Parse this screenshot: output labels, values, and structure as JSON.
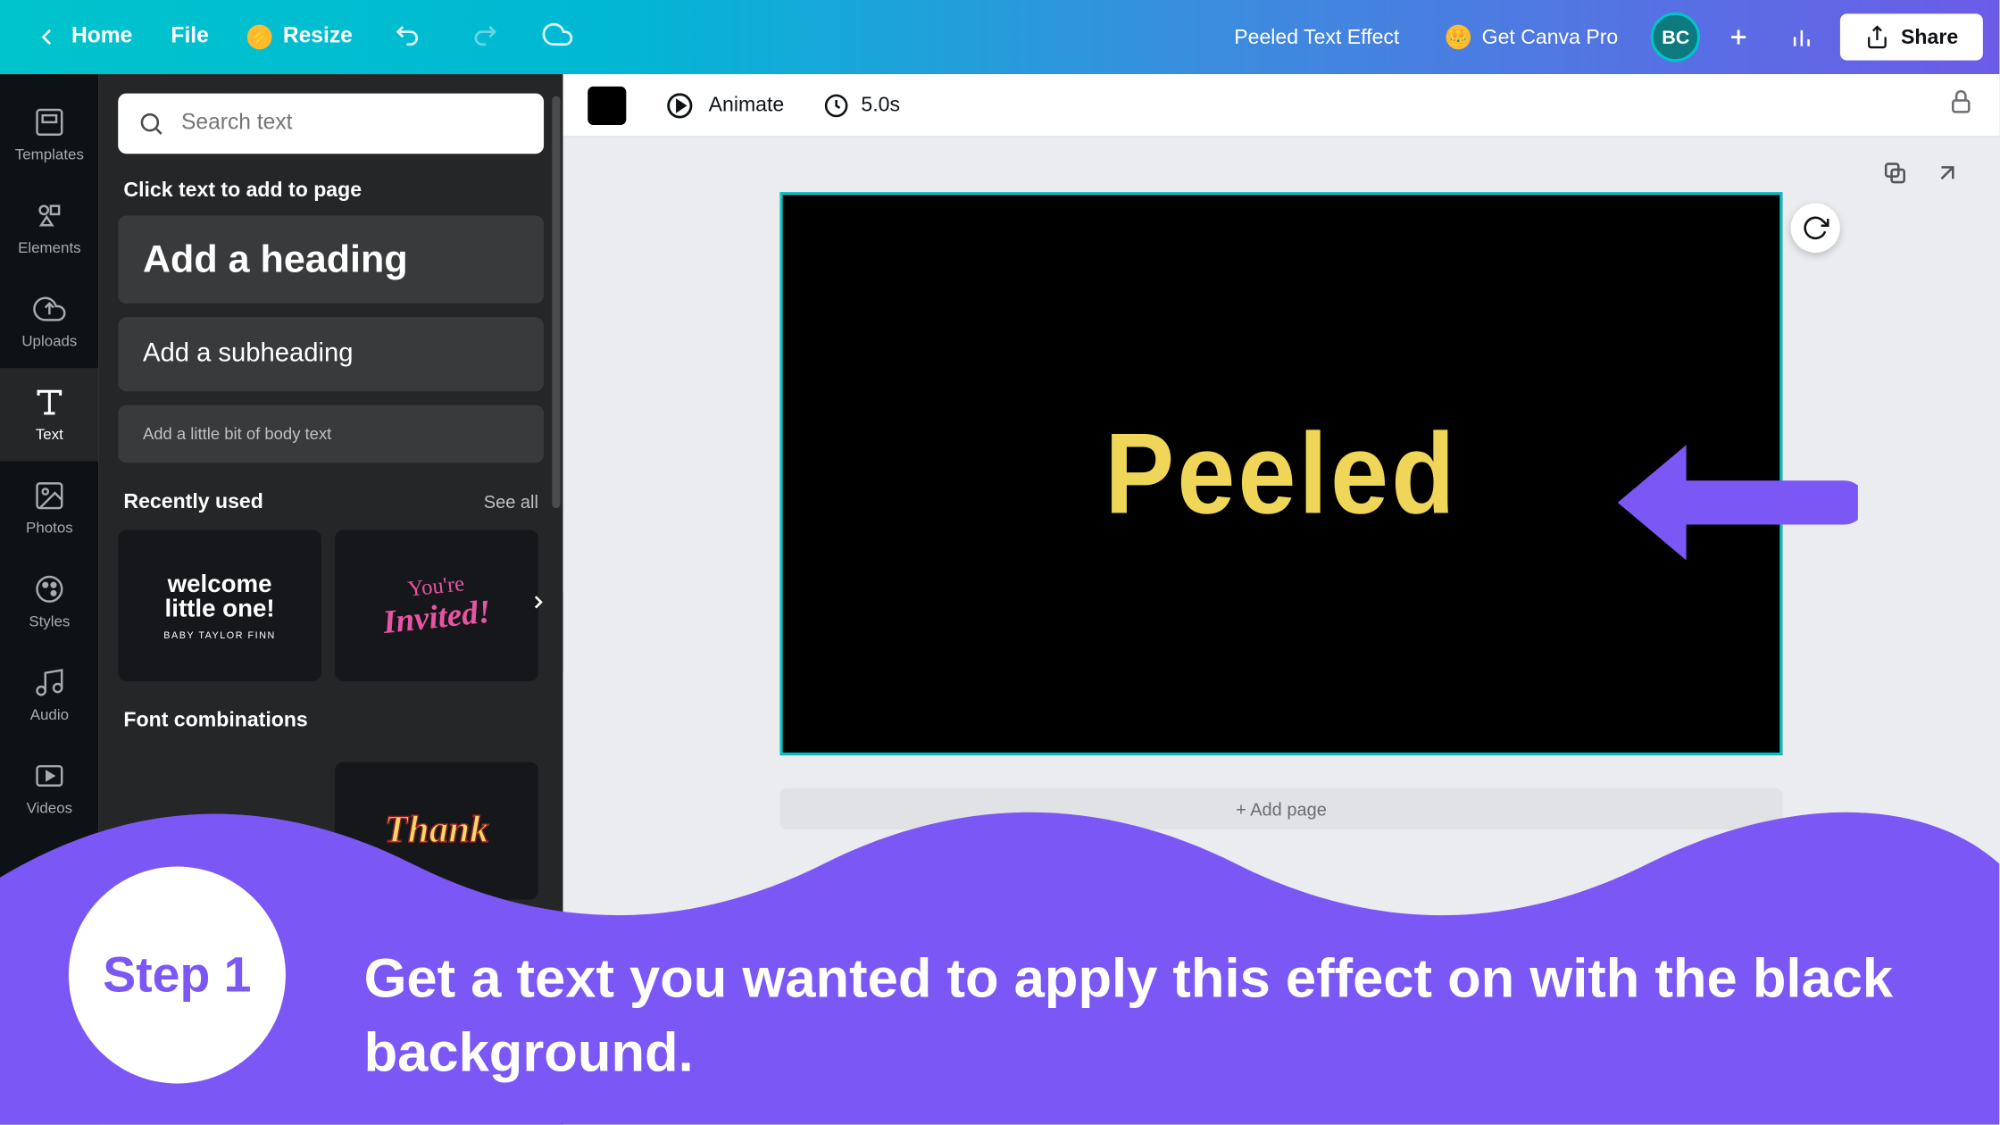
{
  "topbar": {
    "home": "Home",
    "file": "File",
    "resize": "Resize",
    "doc_title": "Peeled Text Effect",
    "get_pro": "Get Canva Pro",
    "avatar_initials": "BC",
    "share": "Share"
  },
  "rail": {
    "templates": "Templates",
    "elements": "Elements",
    "uploads": "Uploads",
    "text": "Text",
    "photos": "Photos",
    "styles": "Styles",
    "audio": "Audio",
    "videos": "Videos"
  },
  "sidepanel": {
    "search_placeholder": "Search text",
    "click_hint": "Click text to add to page",
    "heading": "Add a heading",
    "subheading": "Add a subheading",
    "body": "Add a little bit of body text",
    "recently_used": "Recently used",
    "see_all": "See all",
    "font_combos": "Font combinations",
    "card1_line1": "welcome",
    "card1_line2": "little one!",
    "card1_sub": "BABY TAYLOR FINN",
    "card2_line1": "You're",
    "card2_line2": "Invited!",
    "thank": "Thank"
  },
  "toolbar": {
    "animate": "Animate",
    "duration": "5.0s"
  },
  "canvas": {
    "text": "Peeled",
    "add_page": "+ Add page"
  },
  "overlay": {
    "step_label": "Step 1",
    "instruction": "Get a text you wanted to apply this effect on with the black background."
  },
  "colors": {
    "accent_purple": "#7b58f6",
    "text_yellow": "#efd558",
    "canva_teal": "#00c4cc"
  }
}
